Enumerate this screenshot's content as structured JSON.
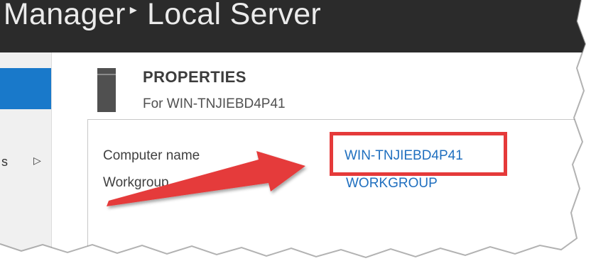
{
  "window": {
    "title_left": "r Manager",
    "separator": "▸",
    "title_right": "Local Server"
  },
  "nav": {
    "partial_label": "s",
    "expand_glyph": "▷"
  },
  "properties": {
    "heading": "PROPERTIES",
    "subtitle": "For WIN-TNJIEBD4P41",
    "rows": [
      {
        "label": "Computer name",
        "value": "WIN-TNJIEBD4P41"
      },
      {
        "label": "Workgroup",
        "value": "WORKGROUP"
      }
    ]
  },
  "colors": {
    "titlebar": "#2b2b2b",
    "nav_selected": "#1979ca",
    "link": "#1f6fbf",
    "annotation": "#e53a3a"
  },
  "icons": [
    "server-icon",
    "expand-arrow-icon",
    "annotation-arrow"
  ]
}
